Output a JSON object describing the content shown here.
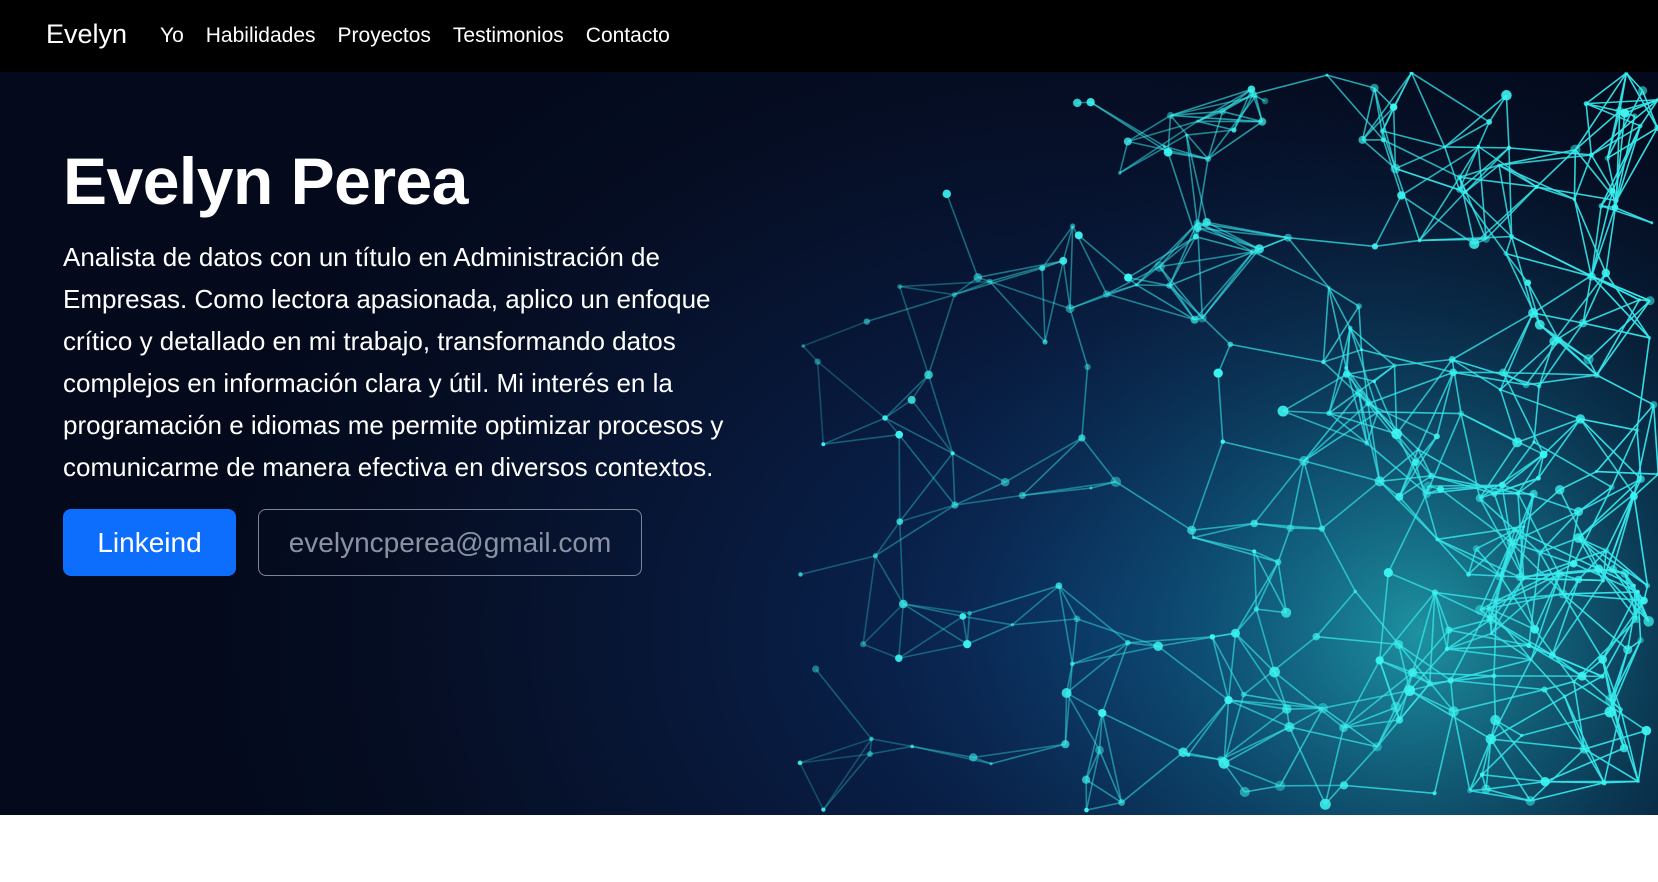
{
  "navbar": {
    "brand": "Evelyn",
    "links": [
      {
        "label": "Yo"
      },
      {
        "label": "Habilidades"
      },
      {
        "label": "Proyectos"
      },
      {
        "label": "Testimonios"
      },
      {
        "label": "Contacto"
      }
    ]
  },
  "hero": {
    "title": "Evelyn Perea",
    "description": "Analista de datos con un título en Administración de Empresas. Como lectora apasionada, aplico un enfoque crítico y detallado en mi trabajo, transformando datos complejos en información clara y útil. Mi interés en la programación e idiomas me permite optimizar procesos y comunicarme de manera efectiva en diversos contextos.",
    "primary_button": "Linkeind",
    "secondary_button": "evelyncperea@gmail.com"
  },
  "colors": {
    "navbar_bg": "#000000",
    "hero_bg": "#07153a",
    "primary": "#0d6efd",
    "network_glow": "#2ff3ee"
  }
}
